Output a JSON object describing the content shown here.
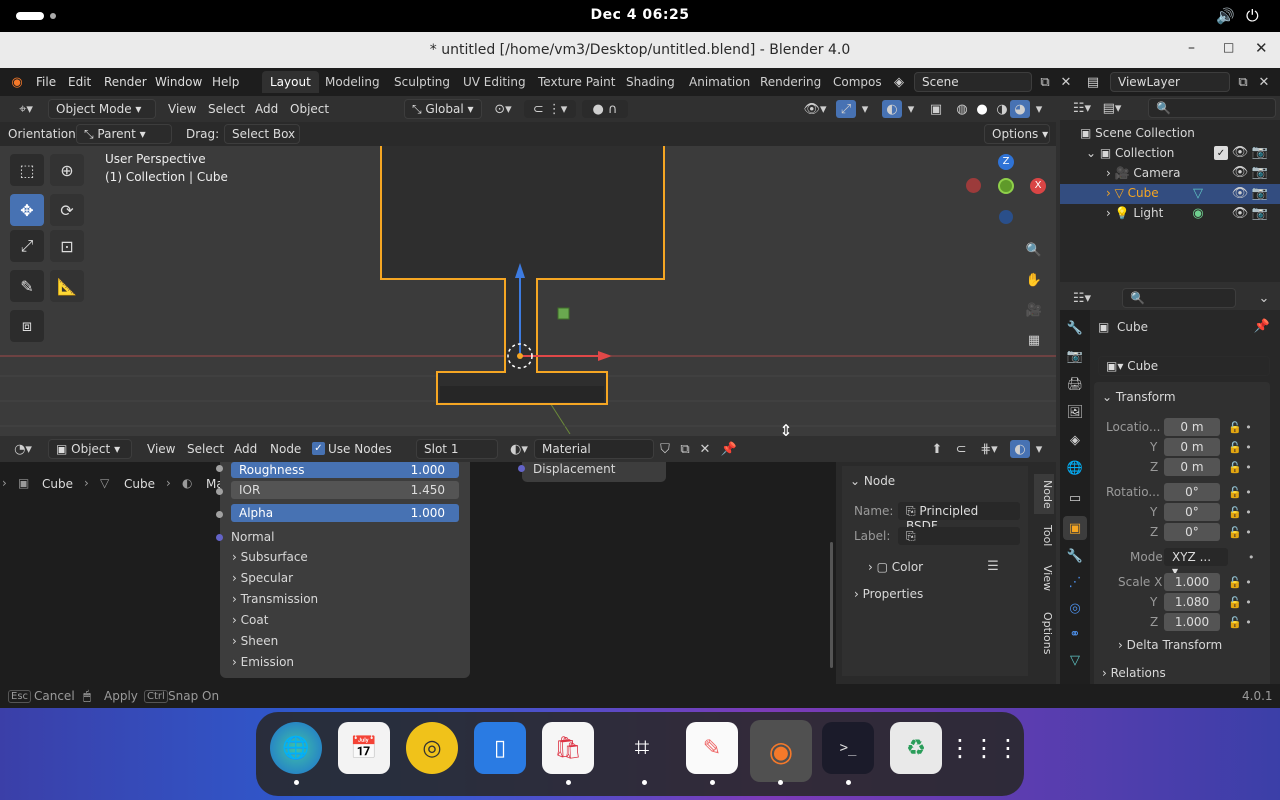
{
  "system": {
    "clock": "Dec 4  06:25"
  },
  "window": {
    "title": "* untitled [/home/vm3/Desktop/untitled.blend] - Blender 4.0"
  },
  "menu": {
    "file": "File",
    "edit": "Edit",
    "render": "Render",
    "window": "Window",
    "help": "Help"
  },
  "workspaces": [
    "Layout",
    "Modeling",
    "Sculpting",
    "UV Editing",
    "Texture Paint",
    "Shading",
    "Animation",
    "Rendering",
    "Compos"
  ],
  "scene": {
    "name": "Scene",
    "view_layer": "ViewLayer"
  },
  "viewport_header": {
    "mode": "Object Mode",
    "view": "View",
    "select": "Select",
    "add": "Add",
    "object": "Object",
    "transform": "Global",
    "options": "Options"
  },
  "tool_settings": {
    "orientation_label": "Orientation:",
    "orientation": "Parent",
    "drag_label": "Drag:",
    "drag": "Select Box"
  },
  "viewport_info": {
    "line1": "User Perspective",
    "line2": "(1) Collection | Cube"
  },
  "gizmo": {
    "z": "Z",
    "x": "X"
  },
  "node_header": {
    "editor": "Object",
    "view": "View",
    "select": "Select",
    "add": "Add",
    "node": "Node",
    "use_nodes": "Use Nodes",
    "slot": "Slot 1",
    "material": "Material"
  },
  "breadcrumb": [
    "Cube",
    "Cube",
    "Material"
  ],
  "node_panel": {
    "displacement": "Displacement",
    "roughness": {
      "label": "Roughness",
      "value": "1.000"
    },
    "ior": {
      "label": "IOR",
      "value": "1.450"
    },
    "alpha": {
      "label": "Alpha",
      "value": "1.000"
    },
    "normal": "Normal",
    "sections": [
      "Subsurface",
      "Specular",
      "Transmission",
      "Coat",
      "Sheen",
      "Emission"
    ]
  },
  "node_sidebar": {
    "title": "Node",
    "name_label": "Name:",
    "name": "Principled BSDF",
    "label_label": "Label:",
    "color": "Color",
    "properties": "Properties",
    "tabs": [
      "Node",
      "Tool",
      "View",
      "Options"
    ]
  },
  "outliner": {
    "scene_collection": "Scene Collection",
    "collection": "Collection",
    "items": [
      "Camera",
      "Cube",
      "Light"
    ]
  },
  "properties": {
    "object_name": "Cube",
    "datablock": "Cube",
    "transform": "Transform",
    "location": {
      "label": "Locatio...",
      "x": "0 m",
      "y": "0 m",
      "z": "0 m"
    },
    "rotation": {
      "label": "Rotatio...",
      "x": "0°",
      "y": "0°",
      "z": "0°"
    },
    "mode_label": "Mode",
    "mode": "XYZ ...",
    "scale": {
      "label": "Scale X",
      "x": "1.000",
      "y": "1.080",
      "z": "1.000"
    },
    "axis_y": "Y",
    "axis_z": "Z",
    "delta": "Delta Transform",
    "relations": "Relations"
  },
  "statusbar": {
    "esc": "Esc",
    "cancel": "Cancel",
    "apply": "Apply",
    "ctrl": "Ctrl",
    "snap": "Snap On",
    "version": "4.0.1"
  },
  "colors": {
    "accent": "#4772b3",
    "selection": "#f5a623",
    "bg": "#303030"
  }
}
